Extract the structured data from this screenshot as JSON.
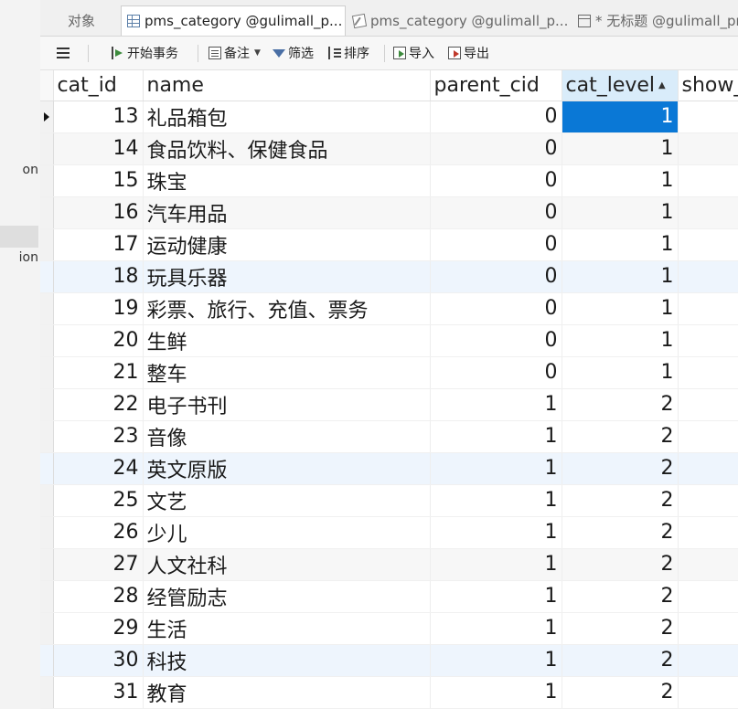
{
  "navigator": {
    "items": [
      {
        "text": "on"
      },
      {
        "text": "ion"
      }
    ]
  },
  "tabs": [
    {
      "label": "对象",
      "icon": "none",
      "active": false
    },
    {
      "label": "pms_category @gulimall_p...",
      "icon": "table-icon",
      "active": true
    },
    {
      "label": "pms_category @gulimall_p...",
      "icon": "design-icon",
      "active": false
    },
    {
      "label": "* 无标题 @gulimall_pms",
      "icon": "query-icon",
      "active": false
    }
  ],
  "toolbar": {
    "begin_transaction": "开始事务",
    "notes": "备注",
    "filter": "筛选",
    "sort": "排序",
    "import": "导入",
    "export": "导出"
  },
  "grid": {
    "columns": [
      "cat_id",
      "name",
      "parent_cid",
      "cat_level",
      "show_status"
    ],
    "sorted_column": "cat_level",
    "sort_direction": "ascending",
    "selected": {
      "row": 0,
      "column": "cat_level"
    },
    "rows": [
      {
        "cat_id": "13",
        "name": "礼品箱包",
        "parent_cid": "0",
        "cat_level": "1"
      },
      {
        "cat_id": "14",
        "name": "食品饮料、保健食品",
        "parent_cid": "0",
        "cat_level": "1"
      },
      {
        "cat_id": "15",
        "name": "珠宝",
        "parent_cid": "0",
        "cat_level": "1"
      },
      {
        "cat_id": "16",
        "name": "汽车用品",
        "parent_cid": "0",
        "cat_level": "1"
      },
      {
        "cat_id": "17",
        "name": "运动健康",
        "parent_cid": "0",
        "cat_level": "1"
      },
      {
        "cat_id": "18",
        "name": "玩具乐器",
        "parent_cid": "0",
        "cat_level": "1"
      },
      {
        "cat_id": "19",
        "name": "彩票、旅行、充值、票务",
        "parent_cid": "0",
        "cat_level": "1"
      },
      {
        "cat_id": "20",
        "name": "生鲜",
        "parent_cid": "0",
        "cat_level": "1"
      },
      {
        "cat_id": "21",
        "name": "整车",
        "parent_cid": "0",
        "cat_level": "1"
      },
      {
        "cat_id": "22",
        "name": "电子书刊",
        "parent_cid": "1",
        "cat_level": "2"
      },
      {
        "cat_id": "23",
        "name": "音像",
        "parent_cid": "1",
        "cat_level": "2"
      },
      {
        "cat_id": "24",
        "name": "英文原版",
        "parent_cid": "1",
        "cat_level": "2"
      },
      {
        "cat_id": "25",
        "name": "文艺",
        "parent_cid": "1",
        "cat_level": "2"
      },
      {
        "cat_id": "26",
        "name": "少儿",
        "parent_cid": "1",
        "cat_level": "2"
      },
      {
        "cat_id": "27",
        "name": "人文社科",
        "parent_cid": "1",
        "cat_level": "2"
      },
      {
        "cat_id": "28",
        "name": "经管励志",
        "parent_cid": "1",
        "cat_level": "2"
      },
      {
        "cat_id": "29",
        "name": "生活",
        "parent_cid": "1",
        "cat_level": "2"
      },
      {
        "cat_id": "30",
        "name": "科技",
        "parent_cid": "1",
        "cat_level": "2"
      },
      {
        "cat_id": "31",
        "name": "教育",
        "parent_cid": "1",
        "cat_level": "2"
      }
    ]
  },
  "colors": {
    "selection": "#0a78d6",
    "sorted_header": "#d9ecfa"
  }
}
